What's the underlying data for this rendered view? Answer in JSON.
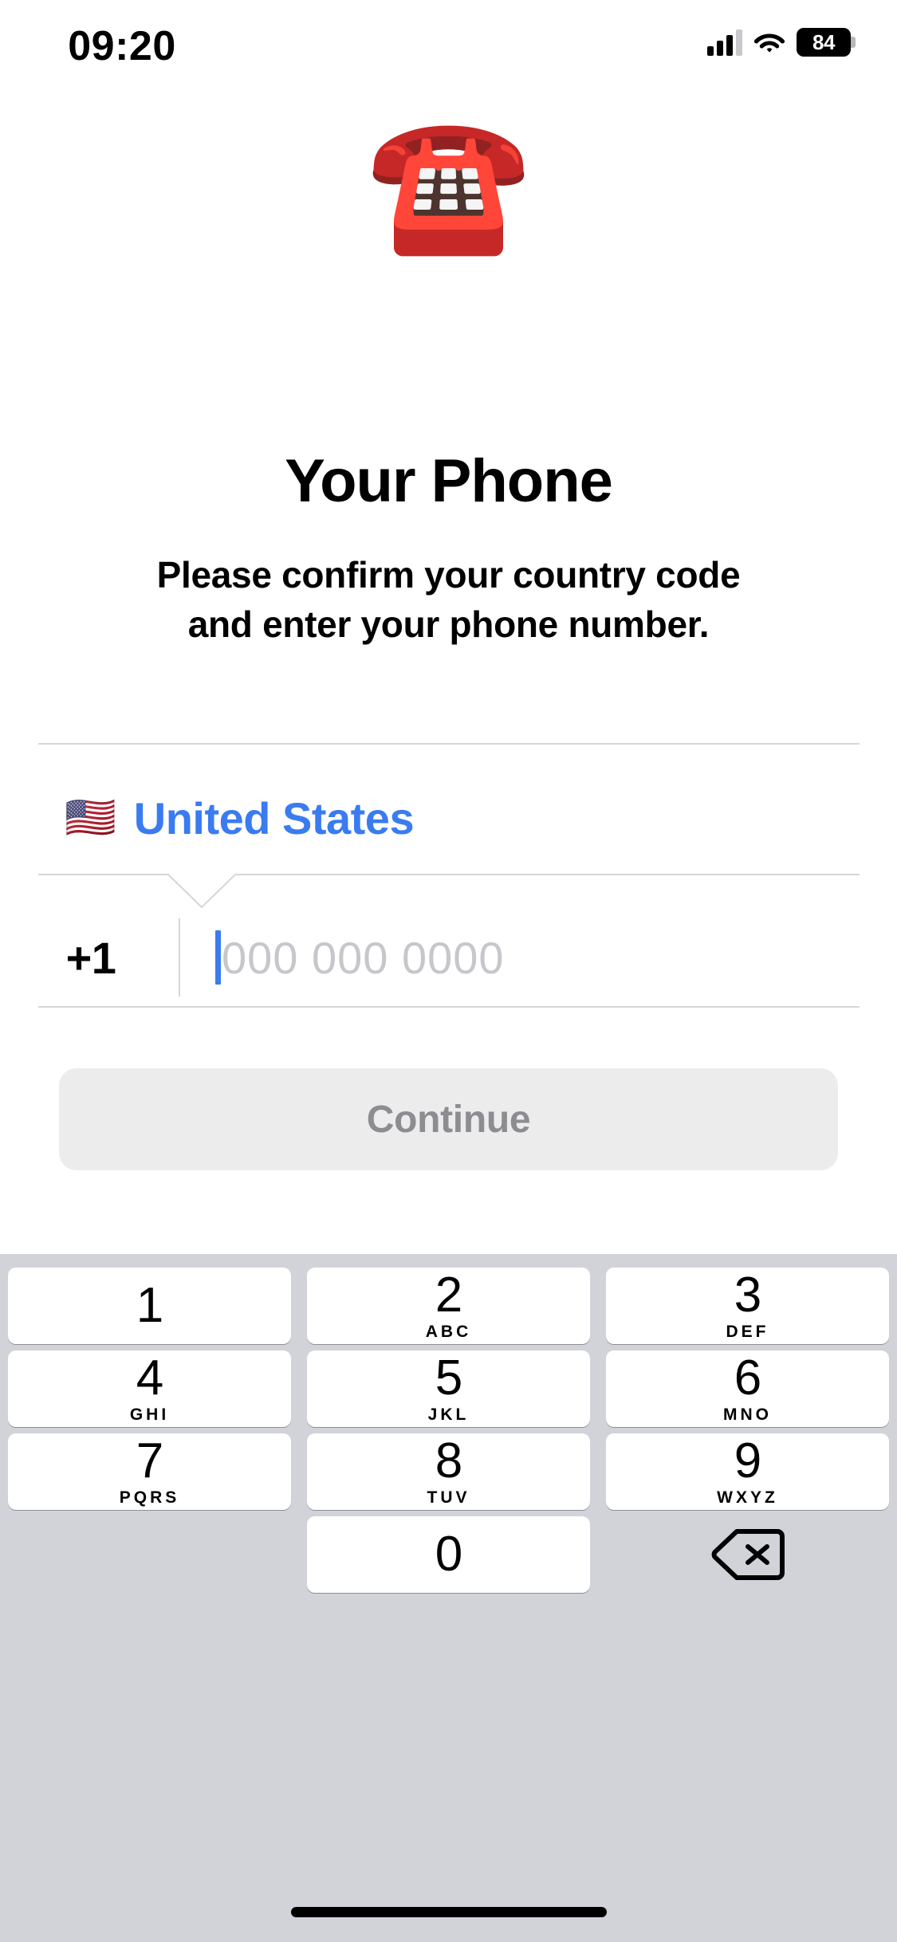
{
  "status_bar": {
    "time": "09:20",
    "battery_percent": "84",
    "cellular_icon": "cellular-signal-icon",
    "wifi_icon": "wifi-icon",
    "battery_icon": "battery-icon"
  },
  "hero": {
    "emoji": "☎️",
    "emoji_name": "telephone-emoji"
  },
  "header": {
    "title": "Your Phone",
    "subtitle_line1": "Please confirm your country code",
    "subtitle_line2": "and enter your phone number."
  },
  "form": {
    "country": {
      "flag": "🇺🇸",
      "name": "United States",
      "accent_color": "#3a7bf0"
    },
    "phone": {
      "dial_code": "+1",
      "placeholder": "000 000 0000",
      "value": "",
      "caret_color": "#3a7bf0"
    }
  },
  "actions": {
    "continue_label": "Continue",
    "continue_enabled": false,
    "continue_bg": "#ececed",
    "continue_text_color": "#8c8c91"
  },
  "keyboard": {
    "background": "#d1d3d9",
    "key_background": "#ffffff",
    "rows": [
      [
        {
          "digit": "1",
          "letters": ""
        },
        {
          "digit": "2",
          "letters": "ABC"
        },
        {
          "digit": "3",
          "letters": "DEF"
        }
      ],
      [
        {
          "digit": "4",
          "letters": "GHI"
        },
        {
          "digit": "5",
          "letters": "JKL"
        },
        {
          "digit": "6",
          "letters": "MNO"
        }
      ],
      [
        {
          "digit": "7",
          "letters": "PQRS"
        },
        {
          "digit": "8",
          "letters": "TUV"
        },
        {
          "digit": "9",
          "letters": "WXYZ"
        }
      ],
      [
        {
          "digit": "",
          "letters": ""
        },
        {
          "digit": "0",
          "letters": ""
        },
        {
          "digit": "",
          "letters": "",
          "icon": "delete-backspace-icon"
        }
      ]
    ]
  }
}
